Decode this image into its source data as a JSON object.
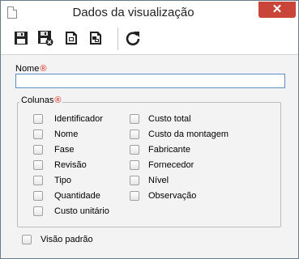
{
  "window": {
    "title": "Dados da visualização",
    "close_symbol": "✕"
  },
  "toolbar": {
    "buttons": [
      {
        "name": "save-icon",
        "tooltip": ""
      },
      {
        "name": "save-and-close-icon",
        "tooltip": ""
      },
      {
        "name": "document-icon",
        "tooltip": ""
      },
      {
        "name": "document-alt-icon",
        "tooltip": ""
      },
      {
        "name": "refresh-icon",
        "tooltip": ""
      }
    ]
  },
  "form": {
    "nome_label": "Nome",
    "nome_value": "",
    "colunas_label": "Colunas",
    "required_mark": "®",
    "columns_left": [
      "Identificador",
      "Nome",
      "Fase",
      "Revisão",
      "Tipo",
      "Quantidade",
      "Custo unitário"
    ],
    "columns_right": [
      "Custo total",
      "Custo da montagem",
      "Fabricante",
      "Fornecedor",
      "Nível",
      "Observação"
    ],
    "default_view_label": "Visão padrão"
  },
  "colors": {
    "close": "#c9453a",
    "required": "#d9261c",
    "input_border": "#5f8dc7"
  }
}
